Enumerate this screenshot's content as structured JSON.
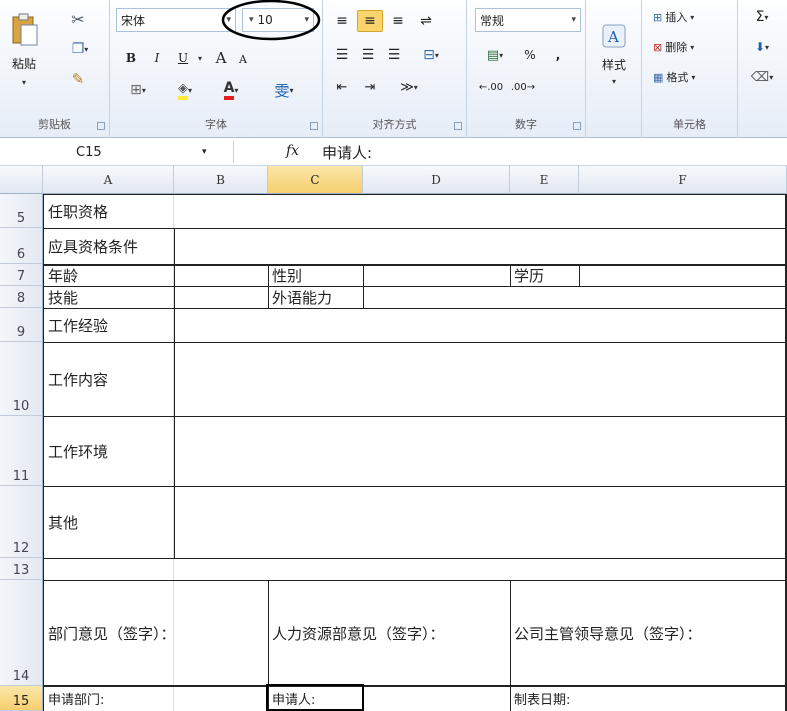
{
  "ribbon": {
    "clipboard": {
      "paste": "粘贴",
      "group": "剪贴板"
    },
    "font": {
      "name": "宋体",
      "size": "10",
      "bold": "B",
      "italic": "I",
      "underline": "U",
      "grow": "A",
      "shrink": "A",
      "wen": "雯",
      "group": "字体"
    },
    "align": {
      "wrap": "≫",
      "group": "对齐方式"
    },
    "number": {
      "format": "常规",
      "percent": "%",
      "comma": ",",
      "inc": ".00",
      "dec": ".00",
      "group": "数字"
    },
    "styles": {
      "label": "样式"
    },
    "cells": {
      "insert": "插入",
      "delete": "删除",
      "format": "格式",
      "group": "单元格"
    },
    "editing": {
      "sum": "Σ"
    }
  },
  "formula_bar": {
    "name_box": "C15",
    "fx": "fx",
    "content": "申请人:"
  },
  "columns": [
    "A",
    "B",
    "C",
    "D",
    "E",
    "F"
  ],
  "rows": [
    "5",
    "6",
    "7",
    "8",
    "9",
    "10",
    "11",
    "12",
    "13",
    "14",
    "15"
  ],
  "cells": {
    "r5a": "任职资格",
    "r6a": "应具资格条件",
    "r7a": "年龄",
    "r7c": "性别",
    "r7e": "学历",
    "r8a": "技能",
    "r8c": "外语能力",
    "r9a": "工作经验",
    "r10a": "工作内容",
    "r11a": "工作环境",
    "r12a": "其他",
    "r14a": "部门意见（签字）：",
    "r14c": "人力资源部意见（签字）：",
    "r14e": "公司主管领导意见（签字）：",
    "r15a": "申请部门:",
    "r15c": "申请人:",
    "r15e": "制表日期:"
  }
}
